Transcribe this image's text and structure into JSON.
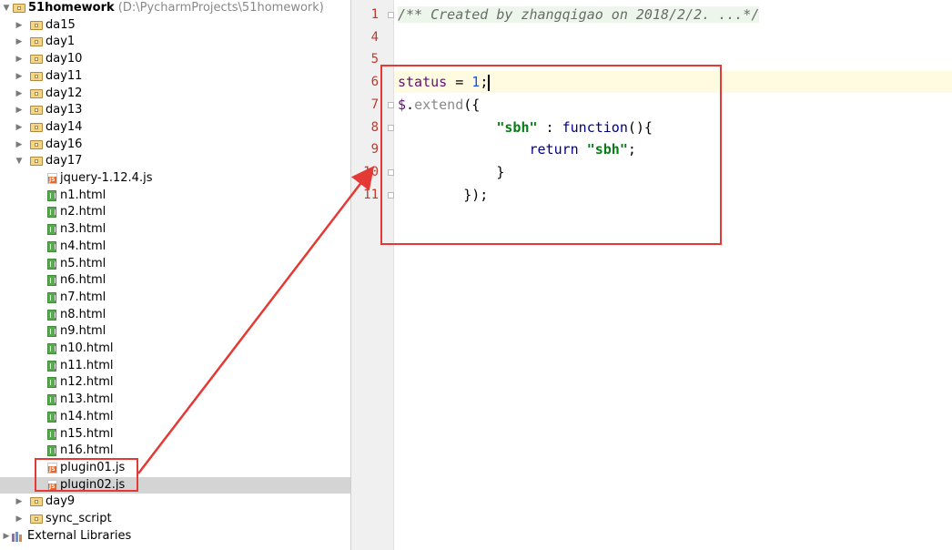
{
  "project": {
    "name": "51homework",
    "path": "(D:\\PycharmProjects\\51homework)"
  },
  "tree": [
    {
      "label": "da15",
      "type": "folder",
      "depth": 1,
      "expanded": false
    },
    {
      "label": "day1",
      "type": "folder",
      "depth": 1,
      "expanded": false
    },
    {
      "label": "day10",
      "type": "folder",
      "depth": 1,
      "expanded": false
    },
    {
      "label": "day11",
      "type": "folder",
      "depth": 1,
      "expanded": false
    },
    {
      "label": "day12",
      "type": "folder",
      "depth": 1,
      "expanded": false
    },
    {
      "label": "day13",
      "type": "folder",
      "depth": 1,
      "expanded": false
    },
    {
      "label": "day14",
      "type": "folder",
      "depth": 1,
      "expanded": false
    },
    {
      "label": "day16",
      "type": "folder",
      "depth": 1,
      "expanded": false
    },
    {
      "label": "day17",
      "type": "folder",
      "depth": 1,
      "expanded": true
    },
    {
      "label": "jquery-1.12.4.js",
      "type": "js",
      "depth": 2
    },
    {
      "label": "n1.html",
      "type": "html",
      "depth": 2
    },
    {
      "label": "n2.html",
      "type": "html",
      "depth": 2
    },
    {
      "label": "n3.html",
      "type": "html",
      "depth": 2
    },
    {
      "label": "n4.html",
      "type": "html",
      "depth": 2
    },
    {
      "label": "n5.html",
      "type": "html",
      "depth": 2
    },
    {
      "label": "n6.html",
      "type": "html",
      "depth": 2
    },
    {
      "label": "n7.html",
      "type": "html",
      "depth": 2
    },
    {
      "label": "n8.html",
      "type": "html",
      "depth": 2
    },
    {
      "label": "n9.html",
      "type": "html",
      "depth": 2
    },
    {
      "label": "n10.html",
      "type": "html",
      "depth": 2
    },
    {
      "label": "n11.html",
      "type": "html",
      "depth": 2
    },
    {
      "label": "n12.html",
      "type": "html",
      "depth": 2
    },
    {
      "label": "n13.html",
      "type": "html",
      "depth": 2
    },
    {
      "label": "n14.html",
      "type": "html",
      "depth": 2
    },
    {
      "label": "n15.html",
      "type": "html",
      "depth": 2
    },
    {
      "label": "n16.html",
      "type": "html",
      "depth": 2
    },
    {
      "label": "plugin01.js",
      "type": "js",
      "depth": 2
    },
    {
      "label": "plugin02.js",
      "type": "js",
      "depth": 2,
      "selected": true
    },
    {
      "label": "day9",
      "type": "folder",
      "depth": 1,
      "expanded": false
    },
    {
      "label": "sync_script",
      "type": "folder",
      "depth": 1,
      "expanded": false
    },
    {
      "label": "External Libraries",
      "type": "libs",
      "depth": 0,
      "expanded": false
    }
  ],
  "editor": {
    "line_numbers": [
      "1",
      "4",
      "5",
      "6",
      "7",
      "8",
      "9",
      "10",
      "11"
    ],
    "current_line": "6",
    "lines": [
      [
        {
          "t": "/** Created by zhangqigao on 2018/2/2. ...*/",
          "c": "comment"
        }
      ],
      [],
      [],
      [
        {
          "t": "status",
          "c": "var"
        },
        {
          "t": " = ",
          "c": ""
        },
        {
          "t": "1",
          "c": "num"
        },
        {
          "t": ";",
          "c": ""
        }
      ],
      [
        {
          "t": "$",
          "c": "var"
        },
        {
          "t": ".",
          "c": ""
        },
        {
          "t": "extend",
          "c": "fn"
        },
        {
          "t": "({",
          "c": ""
        }
      ],
      [
        {
          "t": "            ",
          "c": ""
        },
        {
          "t": "\"sbh\"",
          "c": "str"
        },
        {
          "t": " : ",
          "c": ""
        },
        {
          "t": "function",
          "c": "kw"
        },
        {
          "t": "(){",
          "c": ""
        }
      ],
      [
        {
          "t": "                ",
          "c": ""
        },
        {
          "t": "return",
          "c": "kw"
        },
        {
          "t": " ",
          "c": ""
        },
        {
          "t": "\"sbh\"",
          "c": "str"
        },
        {
          "t": ";",
          "c": ""
        }
      ],
      [
        {
          "t": "            }",
          "c": ""
        }
      ],
      [
        {
          "t": "        });",
          "c": ""
        }
      ]
    ]
  },
  "colors": {
    "annotation": "#e53935",
    "gutter_numbers": "#c0392b",
    "selected_row": "#d4d4d4"
  }
}
